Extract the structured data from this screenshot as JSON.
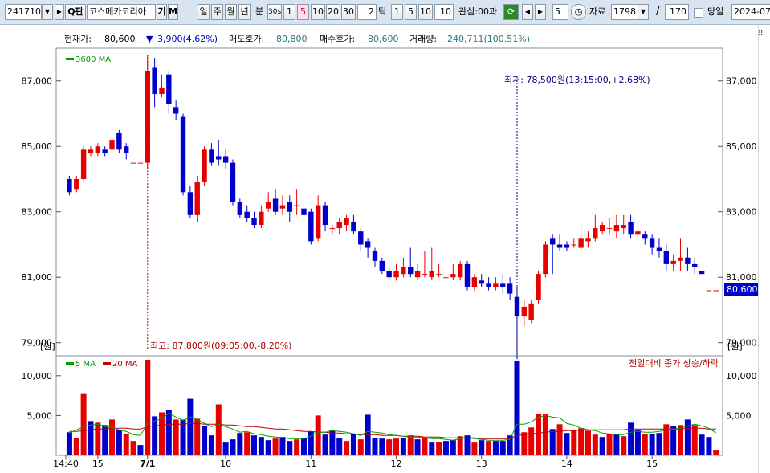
{
  "toolbar": {
    "code": "241710",
    "search_icon_label": "Q",
    "search_label": "판",
    "name": "코스메카코리아",
    "btn_gi": "기",
    "btn_m": "M",
    "periods": [
      "일",
      "주",
      "월",
      "년"
    ],
    "minute_label": "분",
    "sec30": "30s",
    "minutes": [
      "1",
      "5",
      "10",
      "20",
      "30"
    ],
    "tick_count": "2",
    "tick_label": "틱",
    "ticks": [
      "1",
      "5",
      "10"
    ],
    "tick_input": "10",
    "interest": "관심:00",
    "interest_suffix": "과",
    "step": "5",
    "data_label": "자료",
    "data_value": "1798",
    "slash": "/",
    "range_value": "170",
    "today_label": "당일",
    "date_value": "2024-07-"
  },
  "info": {
    "price_label": "현재가:",
    "price": "80,600",
    "change_arrow": "▼",
    "change": "3,900(4.62%)",
    "ask_label": "매도호가:",
    "ask": "80,800",
    "bid_label": "매수호가:",
    "bid": "80,600",
    "volume_label": "거래량:",
    "volume": "240,711(100.51%)"
  },
  "main_chart": {
    "legend_ma": "3600 MA",
    "low_annotation": "최저: 78,500원(13:15:00,+2.68%)",
    "high_annotation": "최고: 87,800원(09:05:00,-8.20%)",
    "current_price_tag": "80,600",
    "unit": "[원]",
    "y_ticks": [
      "87,000",
      "85,000",
      "83,000",
      "81,000",
      "79,000"
    ]
  },
  "volume_chart": {
    "legend_ma5": "5 MA",
    "legend_ma20": "20 MA",
    "caption": "전일대비 종가 상승/하락",
    "y_ticks": [
      "10,000",
      "5,000"
    ]
  },
  "x_axis": [
    "14:40",
    "15",
    "7/1",
    "10",
    "11",
    "12",
    "13",
    "14",
    "15"
  ],
  "colors": {
    "up": "#e60000",
    "down": "#0000cc",
    "ma_green": "#00a000",
    "ma_red": "#c00000",
    "annot_blue": "#000080",
    "annot_red": "#b00000",
    "tag_bg": "#0000cc"
  },
  "chart_data": {
    "type": "candlestick",
    "title": "",
    "price_axis": {
      "min": 78600,
      "max": 88000,
      "ticks": [
        79000,
        81000,
        83000,
        85000,
        87000
      ]
    },
    "volume_axis": {
      "min": 0,
      "max": 12500,
      "ticks": [
        5000,
        10000
      ]
    },
    "x_tick_labels": [
      "14:40",
      "15",
      "7/1",
      "10",
      "11",
      "12",
      "13",
      "14",
      "15"
    ],
    "candles": [
      {
        "o": 84000,
        "c": 83600,
        "h": 84100,
        "l": 83500
      },
      {
        "o": 83700,
        "c": 84000,
        "h": 84100,
        "l": 83600
      },
      {
        "o": 84000,
        "c": 84900,
        "h": 85000,
        "l": 83900
      },
      {
        "o": 84800,
        "c": 84900,
        "h": 85000,
        "l": 84700
      },
      {
        "o": 84800,
        "c": 85000,
        "h": 85100,
        "l": 84700
      },
      {
        "o": 84900,
        "c": 84800,
        "h": 85000,
        "l": 84700
      },
      {
        "o": 84900,
        "c": 85200,
        "h": 85300,
        "l": 84800
      },
      {
        "o": 85400,
        "c": 84900,
        "h": 85500,
        "l": 84800
      },
      {
        "o": 85000,
        "c": 84800,
        "h": 85100,
        "l": 84600
      },
      {
        "o": 84500,
        "c": 84500,
        "h": 84500,
        "l": 84500
      },
      {
        "o": 84500,
        "c": 84500,
        "h": 84500,
        "l": 84500
      },
      {
        "o": 84500,
        "c": 87300,
        "h": 87800,
        "l": 84300
      },
      {
        "o": 87400,
        "c": 86600,
        "h": 87700,
        "l": 86200
      },
      {
        "o": 86600,
        "c": 86800,
        "h": 87200,
        "l": 86500
      },
      {
        "o": 87200,
        "c": 86300,
        "h": 87300,
        "l": 86000
      },
      {
        "o": 86200,
        "c": 86000,
        "h": 86400,
        "l": 85800
      },
      {
        "o": 85900,
        "c": 83600,
        "h": 86000,
        "l": 83500
      },
      {
        "o": 83600,
        "c": 82900,
        "h": 83800,
        "l": 82800
      },
      {
        "o": 82900,
        "c": 83900,
        "h": 84100,
        "l": 82700
      },
      {
        "o": 83900,
        "c": 84900,
        "h": 85000,
        "l": 83800
      },
      {
        "o": 84900,
        "c": 84500,
        "h": 85100,
        "l": 84400
      },
      {
        "o": 84700,
        "c": 84600,
        "h": 85200,
        "l": 84400
      },
      {
        "o": 84700,
        "c": 84500,
        "h": 84900,
        "l": 84300
      },
      {
        "o": 84500,
        "c": 83300,
        "h": 84600,
        "l": 83200
      },
      {
        "o": 83300,
        "c": 82900,
        "h": 83400,
        "l": 82800
      },
      {
        "o": 83000,
        "c": 82800,
        "h": 83200,
        "l": 82700
      },
      {
        "o": 82800,
        "c": 82600,
        "h": 83000,
        "l": 82500
      },
      {
        "o": 82600,
        "c": 83000,
        "h": 83200,
        "l": 82500
      },
      {
        "o": 83100,
        "c": 83300,
        "h": 83600,
        "l": 83000
      },
      {
        "o": 83400,
        "c": 83000,
        "h": 83700,
        "l": 82900
      },
      {
        "o": 83100,
        "c": 83200,
        "h": 83500,
        "l": 82900
      },
      {
        "o": 83300,
        "c": 83000,
        "h": 83500,
        "l": 82700
      },
      {
        "o": 83200,
        "c": 83200,
        "h": 83700,
        "l": 82900
      },
      {
        "o": 83100,
        "c": 82900,
        "h": 83200,
        "l": 82700
      },
      {
        "o": 83000,
        "c": 82100,
        "h": 83100,
        "l": 82000
      },
      {
        "o": 82200,
        "c": 83200,
        "h": 83500,
        "l": 82100
      },
      {
        "o": 83200,
        "c": 82600,
        "h": 83300,
        "l": 82400
      },
      {
        "o": 82500,
        "c": 82500,
        "h": 82600,
        "l": 82300
      },
      {
        "o": 82500,
        "c": 82700,
        "h": 82800,
        "l": 82300
      },
      {
        "o": 82600,
        "c": 82800,
        "h": 82900,
        "l": 82400
      },
      {
        "o": 82700,
        "c": 82400,
        "h": 82900,
        "l": 82300
      },
      {
        "o": 82400,
        "c": 82000,
        "h": 82500,
        "l": 81800
      },
      {
        "o": 82100,
        "c": 81900,
        "h": 82200,
        "l": 81600
      },
      {
        "o": 81800,
        "c": 81500,
        "h": 81900,
        "l": 81300
      },
      {
        "o": 81500,
        "c": 81200,
        "h": 81600,
        "l": 81100
      },
      {
        "o": 81200,
        "c": 81000,
        "h": 81300,
        "l": 80900
      },
      {
        "o": 81000,
        "c": 81200,
        "h": 81400,
        "l": 80900
      },
      {
        "o": 81100,
        "c": 81300,
        "h": 81600,
        "l": 81000
      },
      {
        "o": 81300,
        "c": 81100,
        "h": 81900,
        "l": 81000
      },
      {
        "o": 81000,
        "c": 81200,
        "h": 81400,
        "l": 80900
      },
      {
        "o": 81100,
        "c": 81100,
        "h": 81800,
        "l": 81000
      },
      {
        "o": 81000,
        "c": 81200,
        "h": 81900,
        "l": 80900
      },
      {
        "o": 81100,
        "c": 81100,
        "h": 81400,
        "l": 81000
      },
      {
        "o": 81000,
        "c": 81000,
        "h": 81300,
        "l": 80900
      },
      {
        "o": 81000,
        "c": 81100,
        "h": 81400,
        "l": 80900
      },
      {
        "o": 81000,
        "c": 81400,
        "h": 81500,
        "l": 80900
      },
      {
        "o": 81400,
        "c": 80700,
        "h": 81500,
        "l": 80600
      },
      {
        "o": 80700,
        "c": 81000,
        "h": 81100,
        "l": 80600
      },
      {
        "o": 80900,
        "c": 80800,
        "h": 81100,
        "l": 80700
      },
      {
        "o": 80800,
        "c": 80700,
        "h": 81000,
        "l": 80600
      },
      {
        "o": 80700,
        "c": 80800,
        "h": 81000,
        "l": 80600
      },
      {
        "o": 80800,
        "c": 80700,
        "h": 81100,
        "l": 80500
      },
      {
        "o": 80800,
        "c": 80500,
        "h": 81000,
        "l": 80300
      },
      {
        "o": 80400,
        "c": 79800,
        "h": 80700,
        "l": 78500
      },
      {
        "o": 79800,
        "c": 80100,
        "h": 80300,
        "l": 79500
      },
      {
        "o": 79700,
        "c": 80200,
        "h": 80300,
        "l": 79600
      },
      {
        "o": 80300,
        "c": 81100,
        "h": 81200,
        "l": 80200
      },
      {
        "o": 81100,
        "c": 82000,
        "h": 82100,
        "l": 81000
      },
      {
        "o": 82200,
        "c": 82000,
        "h": 82300,
        "l": 81100
      },
      {
        "o": 82000,
        "c": 81900,
        "h": 82300,
        "l": 81800
      },
      {
        "o": 82000,
        "c": 81900,
        "h": 82100,
        "l": 81800
      },
      {
        "o": 82000,
        "c": 82000,
        "h": 82200,
        "l": 81900
      },
      {
        "o": 81900,
        "c": 82200,
        "h": 82600,
        "l": 81800
      },
      {
        "o": 82100,
        "c": 82200,
        "h": 82400,
        "l": 81900
      },
      {
        "o": 82200,
        "c": 82500,
        "h": 82900,
        "l": 82100
      },
      {
        "o": 82400,
        "c": 82600,
        "h": 82700,
        "l": 82300
      },
      {
        "o": 82500,
        "c": 82500,
        "h": 82800,
        "l": 82300
      },
      {
        "o": 82400,
        "c": 82600,
        "h": 82900,
        "l": 82200
      },
      {
        "o": 82500,
        "c": 82600,
        "h": 82900,
        "l": 82300
      },
      {
        "o": 82700,
        "c": 82300,
        "h": 82900,
        "l": 82200
      },
      {
        "o": 82300,
        "c": 82400,
        "h": 82700,
        "l": 82100
      },
      {
        "o": 82300,
        "c": 82200,
        "h": 82400,
        "l": 82000
      },
      {
        "o": 82200,
        "c": 81900,
        "h": 82300,
        "l": 81700
      },
      {
        "o": 81900,
        "c": 81800,
        "h": 82200,
        "l": 81600
      },
      {
        "o": 81800,
        "c": 81400,
        "h": 82000,
        "l": 81200
      },
      {
        "o": 81400,
        "c": 81500,
        "h": 81700,
        "l": 81200
      },
      {
        "o": 81500,
        "c": 81600,
        "h": 82200,
        "l": 81200
      },
      {
        "o": 81600,
        "c": 81400,
        "h": 81900,
        "l": 81200
      },
      {
        "o": 81400,
        "c": 81300,
        "h": 81600,
        "l": 81100
      },
      {
        "o": 81200,
        "c": 81100,
        "h": 81200,
        "l": 81100
      },
      {
        "o": 80600,
        "c": 80600,
        "h": 80600,
        "l": 80600
      },
      {
        "o": 80600,
        "c": 80600,
        "h": 80600,
        "l": 80600
      }
    ],
    "volumes": [
      2900,
      2200,
      7700,
      4300,
      4100,
      3800,
      4500,
      3200,
      2700,
      1800,
      1300,
      12000,
      4900,
      5400,
      5700,
      4500,
      4500,
      7100,
      4600,
      3700,
      2500,
      6400,
      1600,
      2000,
      2800,
      2900,
      2500,
      2300,
      1900,
      2100,
      2300,
      1800,
      2000,
      2200,
      3000,
      5000,
      2600,
      3200,
      2200,
      1800,
      2700,
      2000,
      5100,
      2200,
      2100,
      2000,
      2100,
      2200,
      2500,
      2000,
      2200,
      1600,
      1700,
      1800,
      1900,
      2400,
      2500,
      1600,
      1900,
      1800,
      1800,
      1800,
      2500,
      11800,
      2900,
      3500,
      5200,
      5200,
      3300,
      3900,
      2800,
      3200,
      3400,
      3100,
      2600,
      2300,
      2700,
      2700,
      2400,
      4100,
      3200,
      2700,
      2700,
      2800,
      3900,
      3700,
      3800,
      4500,
      3800,
      2600,
      2300,
      700
    ],
    "volume_direction": [
      "down",
      "up",
      "up",
      "down",
      "up",
      "down",
      "up",
      "down",
      "up",
      "up",
      "down",
      "up",
      "down",
      "up",
      "down",
      "up",
      "down",
      "down",
      "up",
      "down",
      "down",
      "up",
      "down",
      "down",
      "down",
      "up",
      "down",
      "down",
      "down",
      "up",
      "down",
      "down",
      "up",
      "down",
      "down",
      "up",
      "down",
      "down",
      "down",
      "up",
      "down",
      "up",
      "down",
      "down",
      "down",
      "up",
      "up",
      "down",
      "up",
      "down",
      "up",
      "down",
      "up",
      "down",
      "down",
      "up",
      "down",
      "up",
      "down",
      "up",
      "down",
      "down",
      "down",
      "down",
      "up",
      "up",
      "up",
      "up",
      "down",
      "up",
      "down",
      "up",
      "up",
      "up",
      "up",
      "down",
      "up",
      "down",
      "up",
      "down",
      "down",
      "up",
      "down",
      "down",
      "up",
      "down",
      "up",
      "down",
      "up",
      "down",
      "down",
      "up"
    ],
    "ma5_volume": [
      2800,
      3200,
      3600,
      3800,
      3900,
      3600,
      3500,
      3200,
      3000,
      2600,
      2500,
      4000,
      4300,
      4600,
      5300,
      4800,
      4400,
      4800,
      4500,
      4000,
      3600,
      3900,
      3600,
      3300,
      2900,
      3000,
      2700,
      2600,
      2400,
      2300,
      2200,
      2100,
      2100,
      2100,
      2400,
      2900,
      2900,
      3100,
      3000,
      2900,
      2700,
      2500,
      3000,
      2900,
      2800,
      2600,
      2500,
      2400,
      2300,
      2300,
      2200,
      2100,
      2100,
      2000,
      1900,
      2100,
      2200,
      2100,
      2000,
      1900,
      1900,
      1900,
      2000,
      3900,
      3900,
      4200,
      4800,
      5000,
      4800,
      4700,
      4000,
      3800,
      3400,
      3200,
      3100,
      2800,
      2700,
      2600,
      2600,
      2900,
      3000,
      2900,
      2900,
      3000,
      3200,
      3300,
      3400,
      3700,
      3900,
      3700,
      3400,
      2800
    ],
    "ma20_volume": [
      3000,
      3000,
      3100,
      3200,
      3300,
      3300,
      3400,
      3400,
      3400,
      3300,
      3300,
      3600,
      3700,
      3800,
      3900,
      3900,
      3900,
      4000,
      4000,
      3900,
      3900,
      3900,
      3800,
      3800,
      3700,
      3600,
      3600,
      3500,
      3400,
      3300,
      3300,
      3200,
      3100,
      3000,
      3000,
      2900,
      2900,
      2800,
      2800,
      2700,
      2700,
      2600,
      2600,
      2600,
      2500,
      2500,
      2500,
      2400,
      2400,
      2400,
      2300,
      2300,
      2300,
      2200,
      2200,
      2200,
      2200,
      2200,
      2100,
      2100,
      2100,
      2100,
      2100,
      2500,
      2600,
      2700,
      2800,
      2900,
      3000,
      3000,
      3100,
      3100,
      3200,
      3200,
      3200,
      3200,
      3200,
      3200,
      3200,
      3300,
      3300,
      3300,
      3300,
      3300,
      3300,
      3300,
      3300,
      3400,
      3400,
      3400,
      3300,
      3300
    ]
  }
}
